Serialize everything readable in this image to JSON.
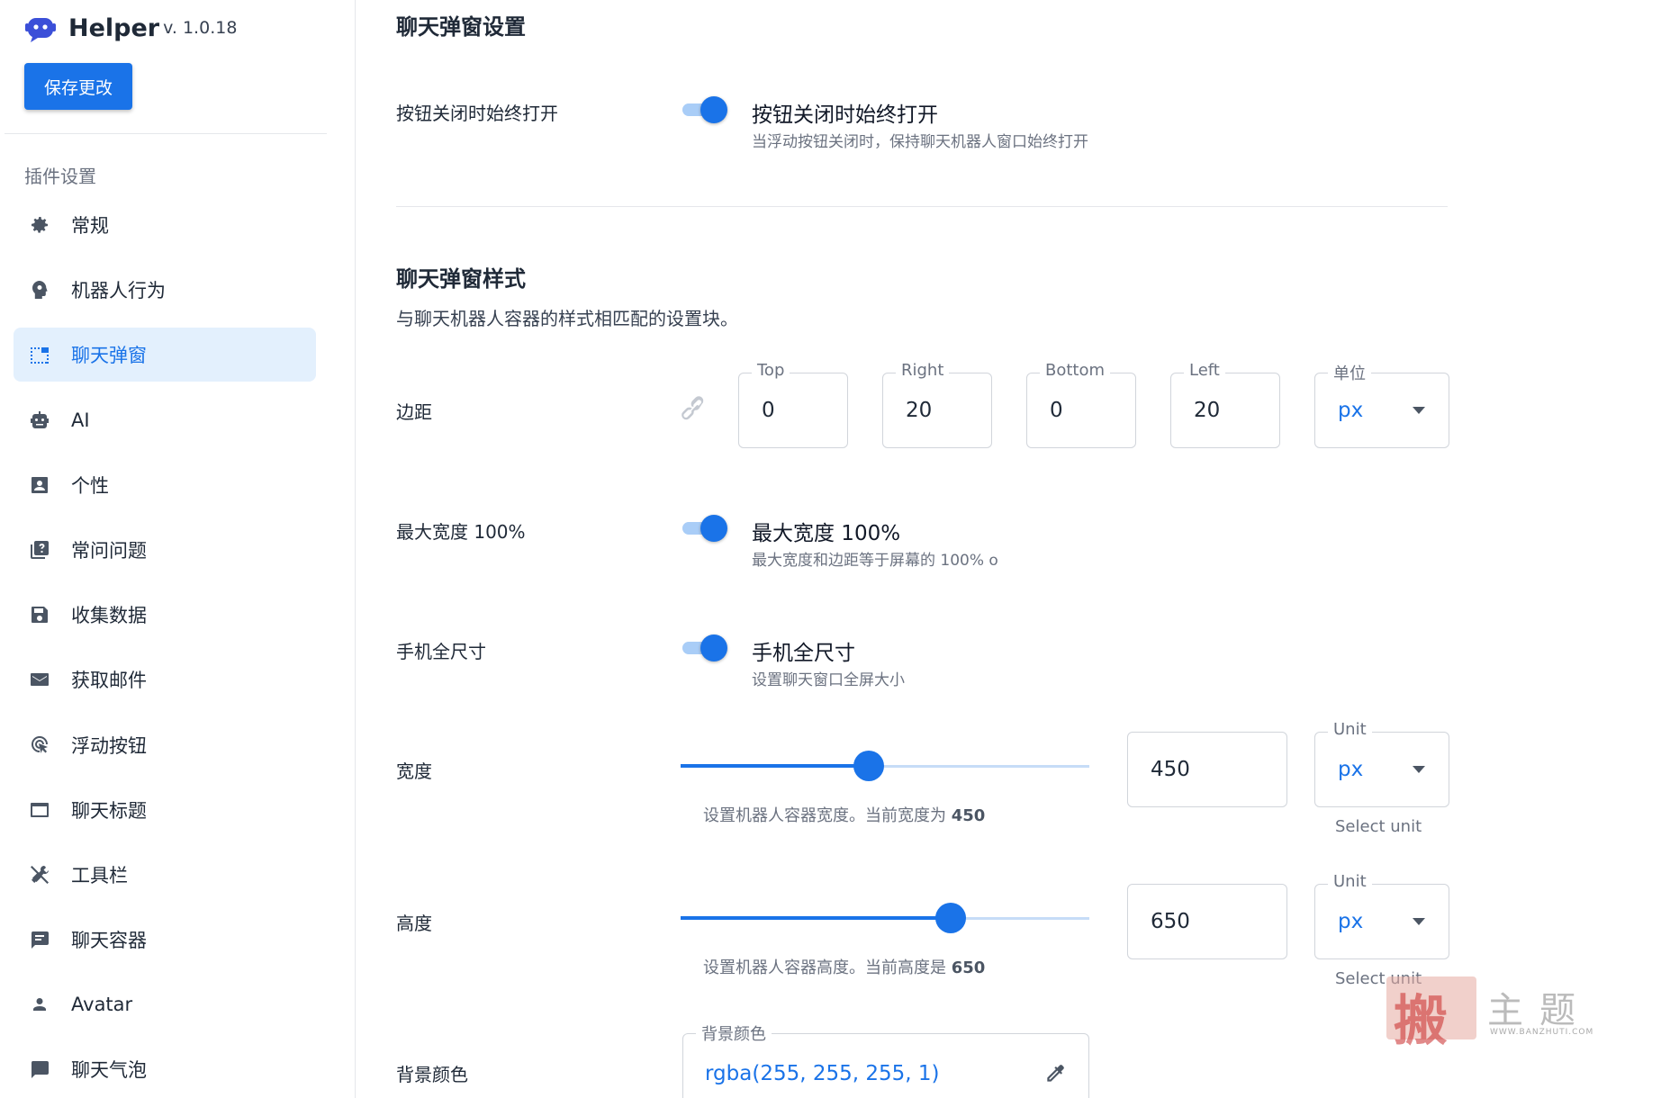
{
  "sidebar": {
    "brand": {
      "name": "Helper",
      "version": "v. 1.0.18"
    },
    "save_label": "保存更改",
    "section_label": "插件设置",
    "items": [
      {
        "label": "常规",
        "icon": "gear-icon"
      },
      {
        "label": "机器人行为",
        "icon": "head-gear-icon"
      },
      {
        "label": "聊天弹窗",
        "icon": "popup-window-icon",
        "active": true
      },
      {
        "label": "AI",
        "icon": "robot-icon"
      },
      {
        "label": "个性",
        "icon": "account-box-icon"
      },
      {
        "label": "常问问题",
        "icon": "faq-icon"
      },
      {
        "label": "收集数据",
        "icon": "floppy-icon"
      },
      {
        "label": "获取邮件",
        "icon": "mail-icon"
      },
      {
        "label": "浮动按钮",
        "icon": "touch-icon"
      },
      {
        "label": "聊天标题",
        "icon": "window-icon"
      },
      {
        "label": "工具栏",
        "icon": "tools-icon"
      },
      {
        "label": "聊天容器",
        "icon": "message-text-icon"
      },
      {
        "label": "Avatar",
        "icon": "person-icon"
      },
      {
        "label": "聊天气泡",
        "icon": "chat-bubble-icon"
      }
    ]
  },
  "main": {
    "popup_settings_title": "聊天弹窗设置",
    "always_open": {
      "label": "按钮关闭时始终打开",
      "title": "按钮关闭时始终打开",
      "desc": "当浮动按钮关闭时，保持聊天机器人窗口始终打开",
      "on": true
    },
    "style_title": "聊天弹窗样式",
    "style_desc": "与聊天机器人容器的样式相匹配的设置块。",
    "margin": {
      "label": "边距",
      "top_label": "Top",
      "top": "0",
      "right_label": "Right",
      "right": "20",
      "bottom_label": "Bottom",
      "bottom": "0",
      "left_label": "Left",
      "left": "20",
      "unit_label": "单位",
      "unit": "px"
    },
    "max_width": {
      "label": "最大宽度 100%",
      "title": "最大宽度 100%",
      "desc": "最大宽度和边距等于屏幕的 100% o",
      "on": true
    },
    "mobile_full": {
      "label": "手机全尺寸",
      "title": "手机全尺寸",
      "desc": "设置聊天窗口全屏大小",
      "on": true
    },
    "width": {
      "label": "宽度",
      "value": "450",
      "slider_fraction": 0.46,
      "desc_prefix": "设置机器人容器宽度。当前宽度为",
      "desc_value": "450",
      "unit_label": "Unit",
      "unit": "px",
      "unit_helper": "Select unit"
    },
    "height": {
      "label": "高度",
      "value": "650",
      "slider_fraction": 0.66,
      "desc_prefix": "设置机器人容器高度。当前高度是",
      "desc_value": "650",
      "unit_label": "Unit",
      "unit": "px",
      "unit_helper": "Select unit"
    },
    "bg_color": {
      "label": "背景颜色",
      "field_label": "背景颜色",
      "value": "rgba(255, 255, 255, 1)"
    }
  },
  "watermark": {
    "glyph": "搬",
    "text": "主题",
    "url": "WWW.BANZHUTI.COM"
  },
  "colors": {
    "accent": "#1a73e8",
    "active_bg": "#e3f0fd",
    "track": "#a9cdf7"
  }
}
